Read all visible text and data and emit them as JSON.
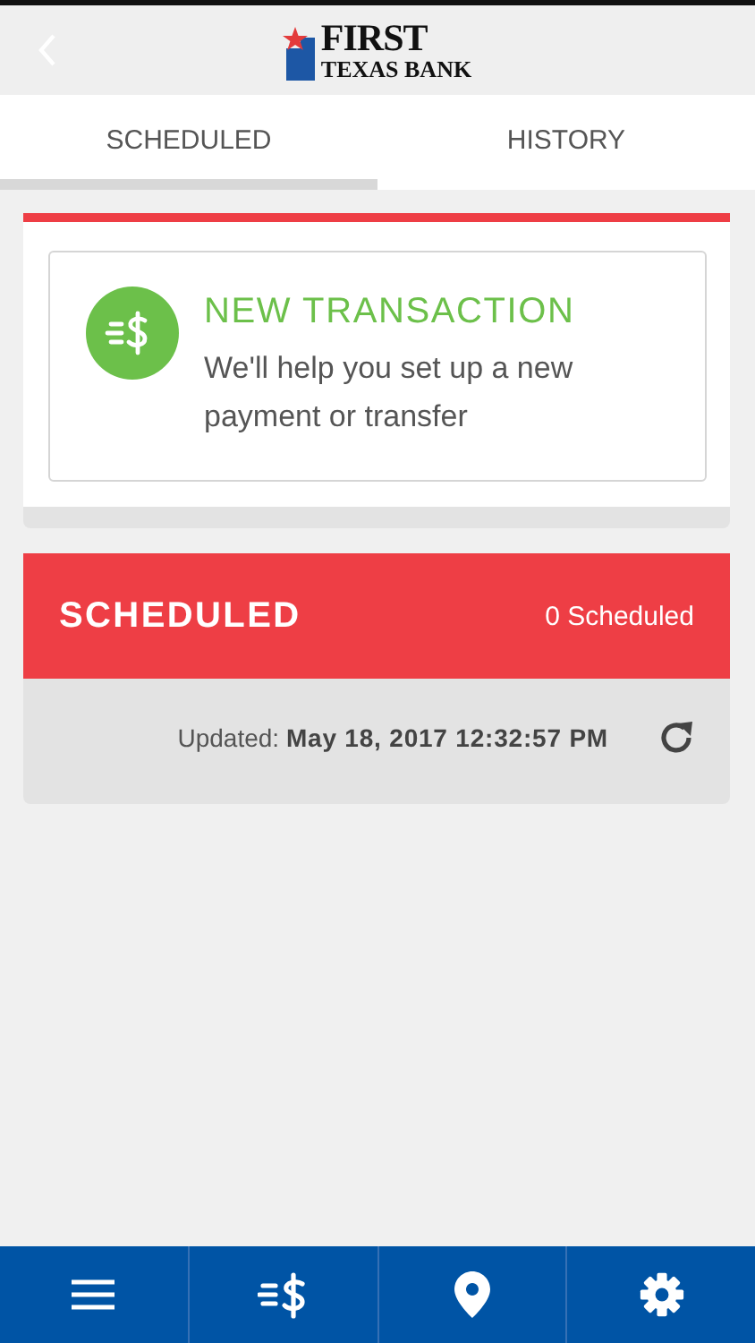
{
  "header": {
    "logo": {
      "line_1": "FIRST",
      "line_2": "TEXAS BANK"
    }
  },
  "tabs": [
    {
      "label": "SCHEDULED",
      "selected": true
    },
    {
      "label": "HISTORY",
      "selected": false
    }
  ],
  "new_transaction": {
    "title": "NEW TRANSACTION",
    "description": "We'll help you set up a new payment or transfer"
  },
  "scheduled": {
    "title": "SCHEDULED",
    "count": "0 Scheduled",
    "updated": "Updated: **May 18, 2017 12:32:57 PM**"
  },
  "bottom_nav": [
    {
      "kind": "menu"
    },
    {
      "kind": "transfer"
    },
    {
      "kind": "location"
    },
    {
      "kind": "settings"
    }
  ]
}
